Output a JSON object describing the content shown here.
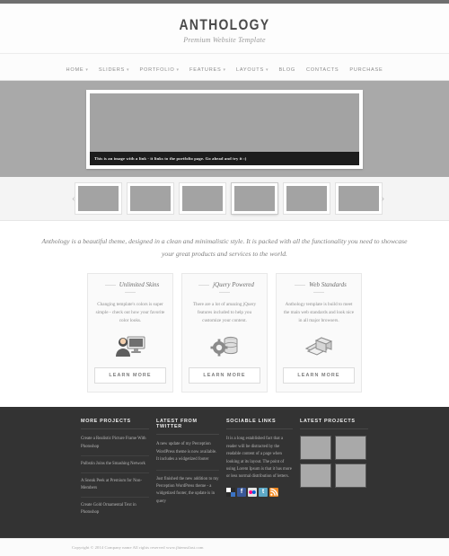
{
  "site": {
    "brand": "ANTHOLOGY",
    "tagline": "Premium Website Template"
  },
  "nav": {
    "items": [
      {
        "label": "HOME",
        "has_dropdown": true
      },
      {
        "label": "SLIDERS",
        "has_dropdown": true
      },
      {
        "label": "PORTFOLIO",
        "has_dropdown": true
      },
      {
        "label": "FEATURES",
        "has_dropdown": true
      },
      {
        "label": "LAYOUTS",
        "has_dropdown": true
      },
      {
        "label": "BLOG",
        "has_dropdown": false
      },
      {
        "label": "CONTACTS",
        "has_dropdown": false
      },
      {
        "label": "PURCHASE",
        "has_dropdown": false
      }
    ]
  },
  "slider": {
    "caption": "This is an image with a link - it links to the portfolio page. Go ahead and try it :)",
    "prev_icon": "‹",
    "next_icon": "›",
    "thumbnail_count": 6,
    "active_thumbnail": 4
  },
  "intro": {
    "text": "Anthology is a beautiful theme, designed in a clean and minimalistic style. It is packed with all the functionality you need to showcase your great products and services to the world."
  },
  "features": {
    "boxes": [
      {
        "title": "Unlimited Skins",
        "text": "Changing template's colors is super simple - check out how your favorite color looks.",
        "icon": "user-monitor-icon",
        "button": "LEARN MORE"
      },
      {
        "title": "jQuery Powered",
        "text": "There are a lot of amazing jQuery features included to help you customize your content.",
        "icon": "gear-database-icon",
        "button": "LEARN MORE"
      },
      {
        "title": "Web Standards",
        "text": "Anthology template is build to meet the main web standards and look nice in all major browsers.",
        "icon": "books-box-icon",
        "button": "LEARN MORE"
      }
    ]
  },
  "footer": {
    "more_projects": {
      "title": "MORE PROJECTS",
      "items": [
        "Create a Realistic Picture Frame With Photoshop",
        "Pulbstin Joins the Smashing Network",
        "A Sneak Peek at Premium for Non-Members",
        "Create Gold Ornamental Text in Photoshop"
      ]
    },
    "twitter": {
      "title": "LATEST FROM TWITTER",
      "tweets": [
        "A new update of my Perception WordPress theme is now available. It includes a widgetized footer",
        "Just finished the new addition to my Perception WordPress theme - a widgetized footer, the update is in query"
      ]
    },
    "sociable": {
      "title": "SOCIABLE LINKS",
      "text": "It is a long established fact that a reader will be distracted by the readable content of a page when looking at its layout. The point of using Lorem Ipsum is that it has more or less normal distribution of letters.",
      "icons": [
        {
          "name": "delicious-icon",
          "glyph": "",
          "color": "#2b2b2b"
        },
        {
          "name": "facebook-icon",
          "glyph": "f",
          "color": "#3b5998"
        },
        {
          "name": "flickr-icon",
          "glyph": "",
          "color": "#e4e4e4"
        },
        {
          "name": "twitter-icon",
          "glyph": "t",
          "color": "#5ea9c6"
        },
        {
          "name": "rss-icon",
          "glyph": "",
          "color": "#f08a24"
        }
      ]
    },
    "latest_projects": {
      "title": "LATEST PROJECTS",
      "thumbnail_count": 4
    }
  },
  "copyright": {
    "text": "Copyright © 2014 Company name All rights reserved www.jhtemsilast.com"
  },
  "colors": {
    "header_bg": "#fdfdfd",
    "slider_band": "#a9a9a9",
    "footer_bg": "#333333",
    "text_muted": "#8e8e8e"
  }
}
